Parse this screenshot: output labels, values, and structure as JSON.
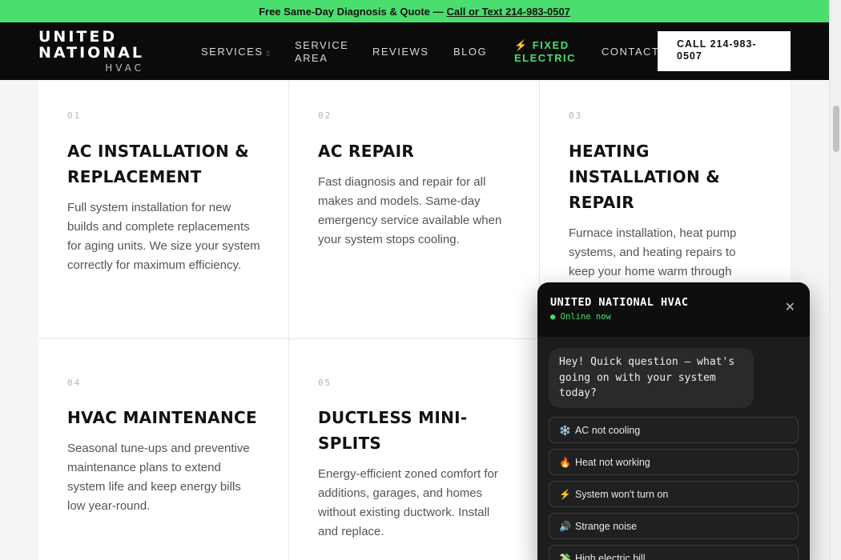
{
  "banner": {
    "text": "Free Same-Day Diagnosis & Quote —",
    "link": "Call or Text 214-983-0507"
  },
  "header": {
    "logo_line1": "UNITED",
    "logo_line2": "NATIONAL",
    "logo_sub": "HVAC",
    "nav": [
      {
        "label": "SERVICES",
        "has_dropdown": true
      },
      {
        "label": "SERVICE",
        "label2": "AREA"
      },
      {
        "label": "REVIEWS"
      },
      {
        "label": "BLOG"
      },
      {
        "label": "⚡ FIXED",
        "label2": "ELECTRIC"
      },
      {
        "label": "CONTACT"
      }
    ],
    "cta_line1": "CALL 214-983-",
    "cta_line2": "0507"
  },
  "services": [
    {
      "num": "01",
      "title": "AC INSTALLATION & REPLACEMENT",
      "desc": "Full system installation for new builds and complete replacements for aging units. We size your system correctly for maximum efficiency."
    },
    {
      "num": "02",
      "title": "AC REPAIR",
      "desc": "Fast diagnosis and repair for all makes and models. Same-day emergency service available when your system stops cooling."
    },
    {
      "num": "03",
      "title": "HEATING INSTALLATION & REPAIR",
      "desc": "Furnace installation, heat pump systems, and heating repairs to keep your home warm through"
    },
    {
      "num": "04",
      "title": "HVAC MAINTENANCE",
      "desc": "Seasonal tune-ups and preventive maintenance plans to extend system life and keep energy bills low year-round."
    },
    {
      "num": "05",
      "title": "DUCTLESS MINI-SPLITS",
      "desc": "Energy-efficient zoned comfort for additions, garages, and homes without existing ductwork. Install and replace."
    }
  ],
  "chat": {
    "title": "UNITED NATIONAL HVAC",
    "status": "● Online now",
    "close": "✕",
    "message": "Hey! Quick question — what's going on with your system today?",
    "options": [
      {
        "emoji": "❄️",
        "label": "AC not cooling"
      },
      {
        "emoji": "🔥",
        "label": "Heat not working"
      },
      {
        "emoji": "⚡",
        "label": "System won't turn on"
      },
      {
        "emoji": "🔊",
        "label": "Strange noise"
      },
      {
        "emoji": "💸",
        "label": "High electric bill"
      }
    ]
  }
}
